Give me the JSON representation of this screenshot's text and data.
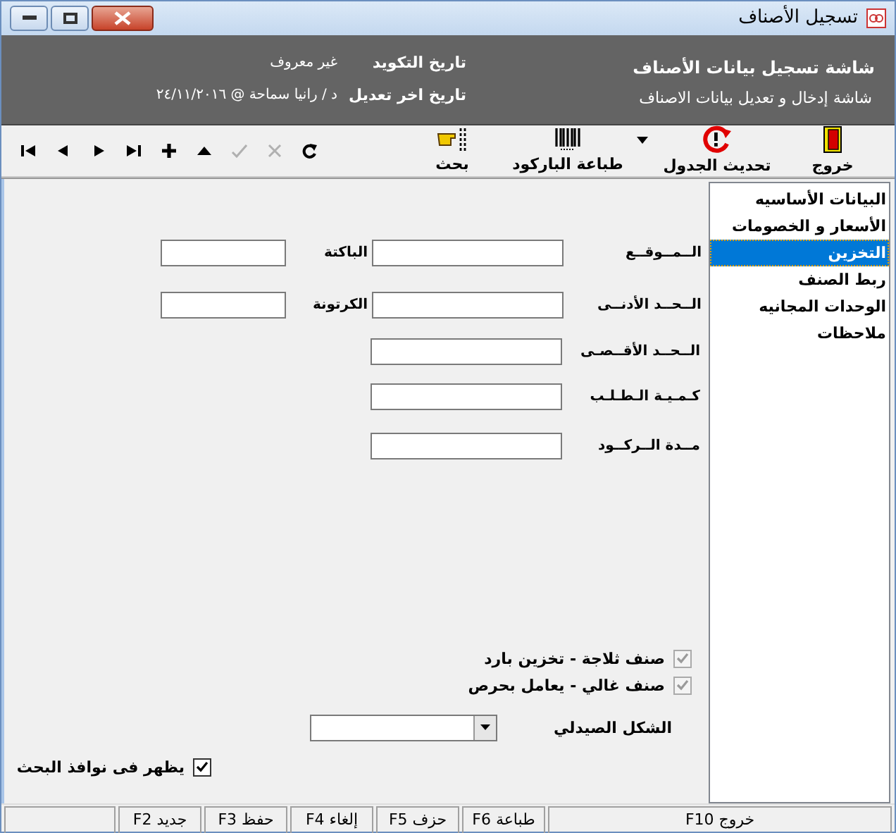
{
  "window": {
    "title": "تسجيل الأصناف"
  },
  "header": {
    "title": "شاشة تسجيل بيانات الأصناف",
    "subtitle": "شاشة إدخال و تعديل بيانات الاصناف",
    "info": [
      {
        "label": "تاريخ التكويد",
        "value": "غير معروف"
      },
      {
        "label": "تاريخ اخر تعديل",
        "value": "د / رانيا سماحة @ ٢٤/١١/٢٠١٦"
      }
    ]
  },
  "toolbar": [
    {
      "kind": "exit",
      "label": "خروج",
      "disabled": false
    },
    {
      "kind": "refresh",
      "label": "تحديث الجدول",
      "disabled": false
    },
    {
      "kind": "dropdown",
      "disabled": false
    },
    {
      "kind": "barcode",
      "label": "طباعة الباركود",
      "disabled": false
    },
    {
      "kind": "search",
      "label": "بحث",
      "disabled": false
    },
    {
      "kind": "redo",
      "disabled": false
    },
    {
      "kind": "cancel",
      "disabled": true
    },
    {
      "kind": "confirm",
      "disabled": true
    },
    {
      "kind": "up",
      "disabled": false
    },
    {
      "kind": "add",
      "disabled": false
    },
    {
      "kind": "last",
      "disabled": false
    },
    {
      "kind": "next",
      "disabled": false
    },
    {
      "kind": "prev",
      "disabled": false
    },
    {
      "kind": "first",
      "disabled": false
    }
  ],
  "sidebar": {
    "items": [
      {
        "label": "البيانات الأساسيه",
        "selected": false
      },
      {
        "label": "الأسعار و الخصومات",
        "selected": false
      },
      {
        "label": "التخزين",
        "selected": true
      },
      {
        "label": "ربط الصنف",
        "selected": false
      },
      {
        "label": "الوحدات المجانيه",
        "selected": false
      },
      {
        "label": "ملاحظات",
        "selected": false
      }
    ]
  },
  "form": {
    "rows": [
      {
        "fields": [
          {
            "label": "الــمــوقــع"
          },
          {
            "label": "الباكتة"
          }
        ]
      },
      {
        "fields": [
          {
            "label": "الــحــد الأدنــى"
          },
          {
            "label": "الكرتونة"
          }
        ]
      },
      {
        "fields": [
          {
            "label": "الــحــد الأقــصـى"
          }
        ]
      },
      {
        "fields": [
          {
            "label": "كـمـيـة الـطـلـب"
          }
        ]
      },
      {
        "fields": [
          {
            "label": "مــدة الــركــود"
          }
        ]
      }
    ],
    "checkboxes": [
      {
        "label": "صنف ثلاجة - تخزين بارد",
        "checked": true,
        "disabled": true
      },
      {
        "label": "صنف غالي - يعامل بحرص",
        "checked": true,
        "disabled": true
      }
    ],
    "combo": {
      "label": "الشكل الصيدلي"
    },
    "search_checkbox": {
      "label": "يظهر فى نوافذ البحث",
      "checked": true,
      "disabled": false
    }
  },
  "status_bar": [
    {
      "label": "خروج F10"
    },
    {
      "label": "طباعة F6"
    },
    {
      "label": "حزف F5"
    },
    {
      "label": "إلغاء F4"
    },
    {
      "label": "حفظ F3"
    },
    {
      "label": "جديد F2"
    }
  ]
}
